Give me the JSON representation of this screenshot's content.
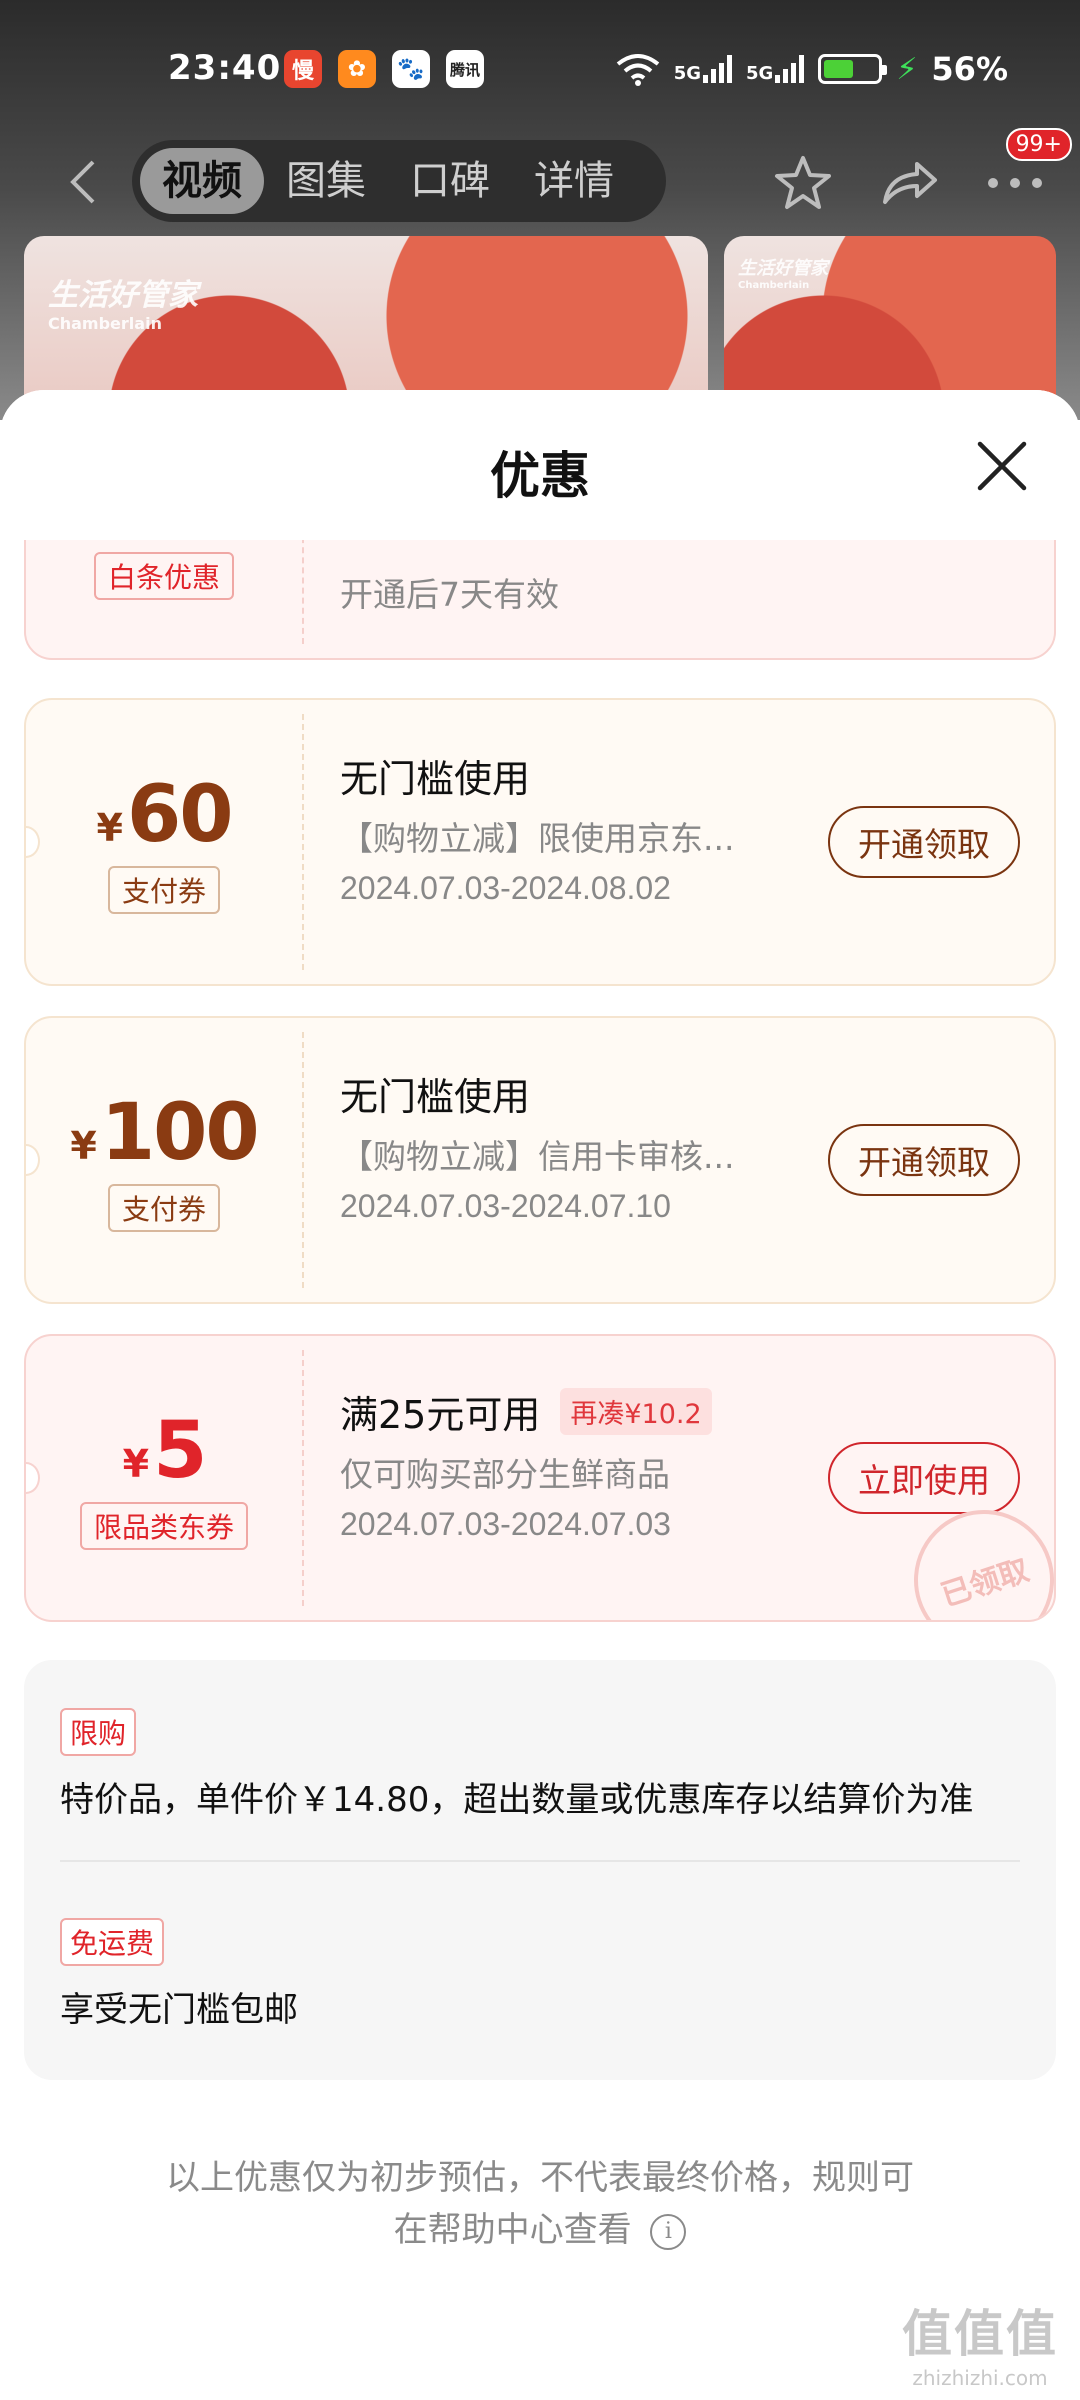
{
  "status_bar": {
    "time": "23:40",
    "notif_icons": [
      {
        "name": "app-notif-icon-1",
        "glyph": "慢"
      },
      {
        "name": "app-notif-icon-2",
        "glyph": "✿"
      },
      {
        "name": "app-notif-icon-3",
        "glyph": "🐾"
      },
      {
        "name": "app-notif-icon-4",
        "glyph": "腾讯"
      }
    ],
    "sig1_label": "5G",
    "sig2_label": "5G",
    "battery_level": 0.56,
    "battery": "56%"
  },
  "nav": {
    "tabs": [
      "视频",
      "图集",
      "口碑",
      "详情"
    ],
    "active_tab": 0,
    "badge": "99+"
  },
  "photos": {
    "brand": "生活好管家",
    "brand_en": "Chamberlain"
  },
  "sheet": {
    "title": "优惠"
  },
  "coupons": [
    {
      "tag": "白条优惠",
      "desc": "开通后7天有效"
    },
    {
      "yen": "¥",
      "amount": "60",
      "tag": "支付券",
      "title": "无门槛使用",
      "desc": "【购物立减】限使用京东...",
      "date": "2024.07.03-2024.08.02",
      "button": "开通领取"
    },
    {
      "yen": "¥",
      "amount": "100",
      "tag": "支付券",
      "title": "无门槛使用",
      "desc": "【购物立减】信用卡审核...",
      "date": "2024.07.03-2024.07.10",
      "button": "开通领取"
    },
    {
      "yen": "¥",
      "amount": "5",
      "tag": "限品类东券",
      "title": "满25元可用",
      "extra": "再凑¥10.2",
      "desc": "仅可购买部分生鲜商品",
      "date": "2024.07.03-2024.07.03",
      "button": "立即使用",
      "stamp": "已领取"
    }
  ],
  "panel": {
    "limit_tag": "限购",
    "limit_text": "特价品，单件价￥14.80，超出数量或优惠库存以结算价为准",
    "shipping_tag": "免运费",
    "shipping_text": "享受无门槛包邮"
  },
  "footer": {
    "line1": "以上优惠仅为初步预估，不代表最终价格，规则可",
    "line2": "在帮助中心查看"
  },
  "watermark": {
    "logo": "值值值",
    "site": "zhizhizhi.com"
  },
  "colors": {
    "brand_red": "#e0242a",
    "coupon_brown": "#8a3b12",
    "coupon_red_bg": "#fff4f3",
    "coupon_brown_bg": "#fffaf4"
  }
}
